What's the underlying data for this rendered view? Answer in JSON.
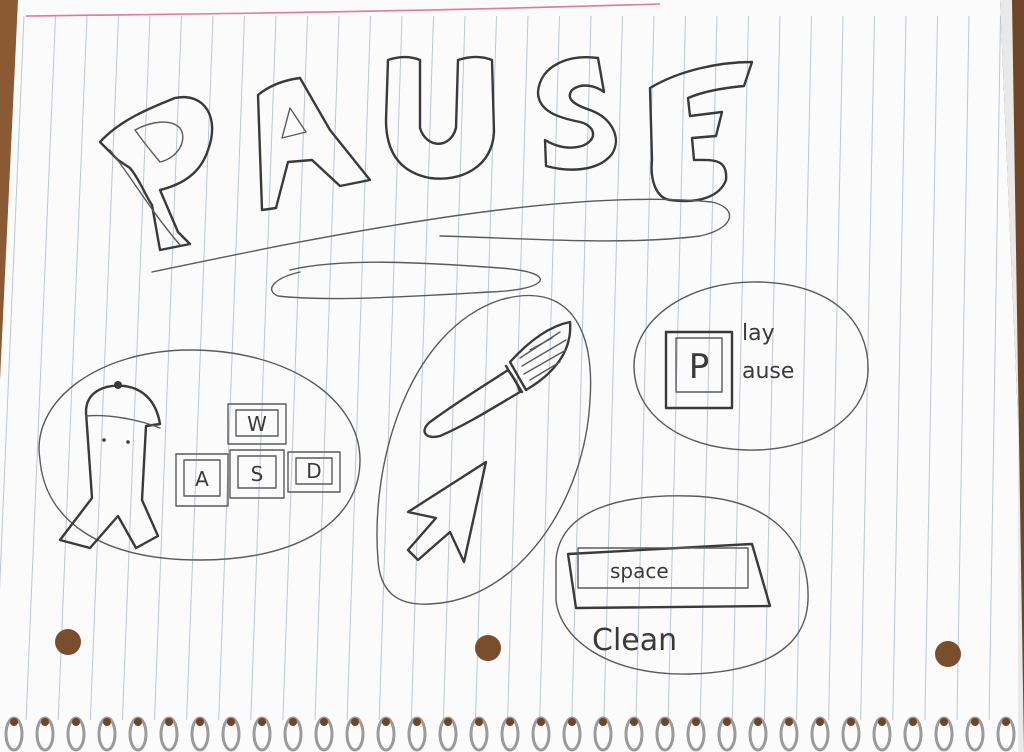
{
  "title": "PAUSE",
  "wasd_keys": [
    "W",
    "A",
    "S",
    "D"
  ],
  "p_key": {
    "letter": "P",
    "label_top": "lay",
    "label_bottom": "ause"
  },
  "space_key": {
    "label": "space",
    "caption": "Clean"
  },
  "colors": {
    "paper": "#fbfbfb",
    "rule_line": "#b9c7dc",
    "margin_line": "#e07a9a",
    "pencil": "#3a3a3a",
    "desk": "#8a5a35"
  },
  "icons": [
    "character-icon",
    "paintbrush-icon",
    "cursor-arrow-icon",
    "spiral-binding-icon"
  ]
}
